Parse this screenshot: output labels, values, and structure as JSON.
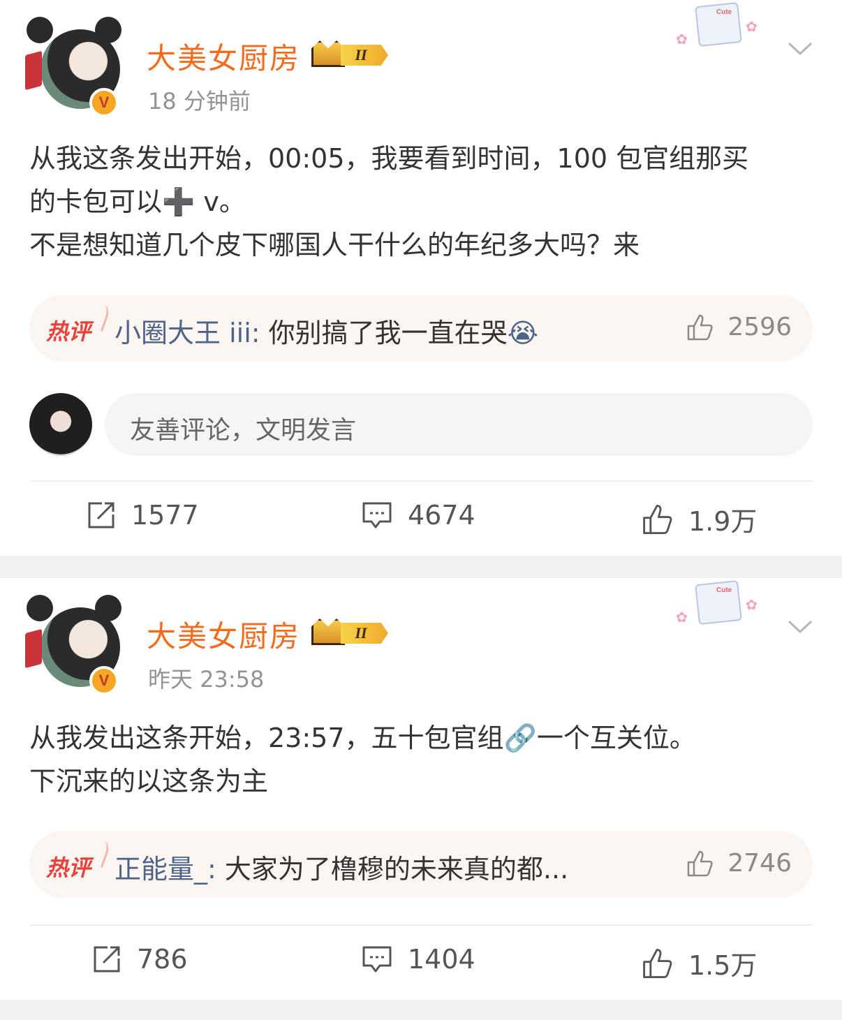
{
  "colors": {
    "username": "#f36b1c",
    "hot_user": "#4d6387",
    "hot_tag": "#e8413a",
    "muted": "#939393"
  },
  "posts": [
    {
      "author": "大美女厨房",
      "level_badge": "II",
      "time": "18 分钟前",
      "body_lines": [
        "从我这条发出开始，00:05，我要看到时间，100 包官组那买",
        "的卡包可以",
        " v。",
        "不是想知道几个皮下哪国人干什么的年纪多大吗？来"
      ],
      "plus_glyph": "➕",
      "hot_comment": {
        "tag": "热评",
        "user": "小圈大王 iii",
        "sep": ": ",
        "text": "你别搞了我一直在哭",
        "emoji": "😭",
        "likes": "2596"
      },
      "comment_placeholder": "友善评论，文明发言",
      "actions": {
        "reposts": "1577",
        "comments": "4674",
        "likes": "1.9万"
      }
    },
    {
      "author": "大美女厨房",
      "level_badge": "II",
      "time": "昨天 23:58",
      "body_lines": [
        "从我发出这条开始，23:57，五十包官组",
        "一个互关位。",
        "下沉来的以这条为主"
      ],
      "link_glyph": "🔗",
      "hot_comment": {
        "tag": "热评",
        "user": "正能量_",
        "sep": ": ",
        "text": "大家为了橹穆的未来真的都...",
        "likes": "2746"
      },
      "actions": {
        "reposts": "786",
        "comments": "1404",
        "likes": "1.5万"
      }
    }
  ],
  "sticker_text": "Cute"
}
